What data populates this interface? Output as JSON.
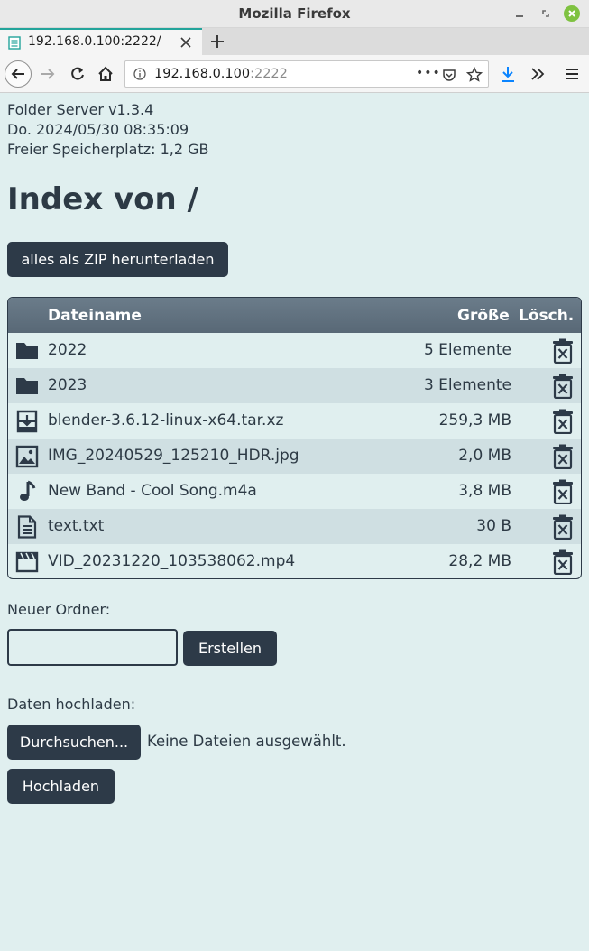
{
  "window": {
    "title": "Mozilla Firefox"
  },
  "tab": {
    "label": "192.168.0.100:2222/"
  },
  "urlbar": {
    "host": "192.168.0.100",
    "port": ":2222",
    "more": "•••"
  },
  "page": {
    "server_name": "Folder Server v1.3.4",
    "datetime": "Do. 2024/05/30 08:35:09",
    "free_space": "Freier Speicherplatz: 1,2 GB",
    "heading": "Index von /",
    "zip_button": "alles als ZIP herunterladen",
    "table": {
      "headers": {
        "name": "Dateiname",
        "size": "Größe",
        "delete": "Lösch."
      },
      "rows": [
        {
          "icon": "folder-icon",
          "name": "2022",
          "size": "5 Elemente"
        },
        {
          "icon": "folder-icon",
          "name": "2023",
          "size": "3 Elemente"
        },
        {
          "icon": "archive-icon",
          "name": "blender-3.6.12-linux-x64.tar.xz",
          "size": "259,3 MB"
        },
        {
          "icon": "image-icon",
          "name": "IMG_20240529_125210_HDR.jpg",
          "size": "2,0 MB"
        },
        {
          "icon": "music-note-icon",
          "name": "New Band - Cool Song.m4a",
          "size": "3,8 MB"
        },
        {
          "icon": "text-file-icon",
          "name": "text.txt",
          "size": "30 B"
        },
        {
          "icon": "video-icon",
          "name": "VID_20231220_103538062.mp4",
          "size": "28,2 MB"
        }
      ]
    },
    "new_folder": {
      "label": "Neuer Ordner:",
      "input_value": "",
      "create_button": "Erstellen"
    },
    "upload": {
      "label": "Daten hochladen:",
      "browse_button": "Durchsuchen...",
      "no_file_text": "Keine Dateien ausgewählt.",
      "upload_button": "Hochladen"
    }
  },
  "colors": {
    "background": "#e0efef",
    "button": "#2d3a48",
    "tab_accent": "#23a49b",
    "download_accent": "#0a84ff"
  }
}
